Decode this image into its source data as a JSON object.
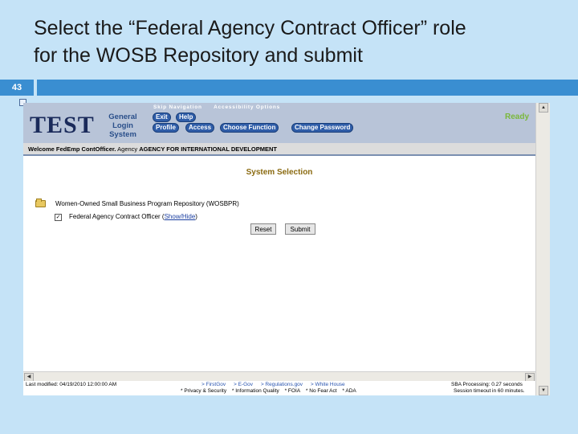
{
  "slide": {
    "title_line1": "Select the “Federal Agency Contract Officer” role",
    "title_line2": "for the WOSB Repository and submit",
    "number": "43"
  },
  "header": {
    "logo": "TEST",
    "system_name": [
      "General",
      "Login",
      "System"
    ],
    "skip_nav": "Skip Navigation",
    "accessibility": "Accessibility Options",
    "nav_buttons": [
      "Exit",
      "Help",
      "Profile",
      "Access",
      "Choose Function",
      "Change Password"
    ],
    "status": "Ready"
  },
  "welcome": {
    "prefix": "Welcome FedEmp ContOfficer.",
    "agency_label": "Agency",
    "agency_name": "AGENCY FOR INTERNATIONAL DEVELOPMENT"
  },
  "main": {
    "title": "System Selection",
    "repository": "Women-Owned Small Business Program Repository (WOSBPR)",
    "role_label": "Federal Agency Contract Officer",
    "role_link_open": "(",
    "role_link": "Show/Hide",
    "role_link_close": ")",
    "role_checked": true,
    "reset_label": "Reset",
    "submit_label": "Submit"
  },
  "footer": {
    "last_modified": "Last modified: 04/19/2010 12:00:00 AM",
    "links": [
      "> FirstGov",
      "> E-Gov",
      "> Regulations.gov",
      "> White House"
    ],
    "policy_links": [
      "* Privacy & Security",
      "* Information Quality",
      "* FOIA",
      "* No Fear Act",
      "* ADA"
    ],
    "processing": "SBA Processing:  0.27 seconds",
    "session": "Session timeout in 60 minutes."
  },
  "colors": {
    "slide_bg": "#c5e3f7",
    "slide_bar": "#3a8ed1",
    "nav_button": "#2f5da8",
    "header_bg": "#b8c4d8",
    "section_title": "#8a6a10",
    "ready": "#7ab83a"
  },
  "icons": {
    "folder": "folder-icon",
    "checkbox": "checkbox-checked-icon",
    "scroll_up": "arrow-up-icon",
    "scroll_down": "arrow-down-icon",
    "scroll_left": "arrow-left-icon",
    "scroll_right": "arrow-right-icon"
  }
}
